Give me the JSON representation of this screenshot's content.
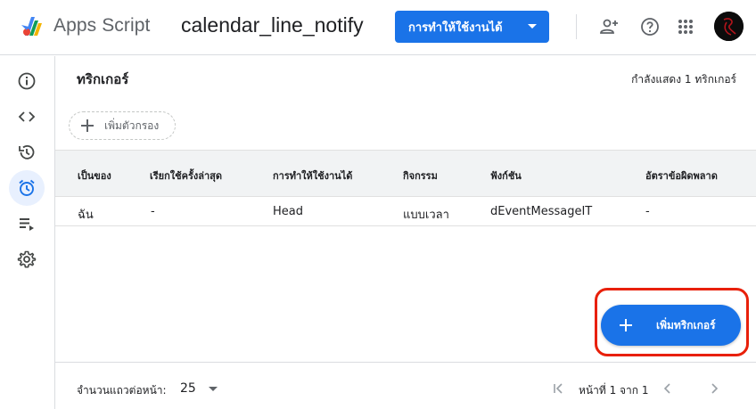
{
  "header": {
    "app_name": "Apps Script",
    "project_name": "calendar_line_notify",
    "deploy_label": "การทำให้ใช้งานได้",
    "icons": [
      "logo-icon",
      "share-person-icon",
      "help-icon",
      "apps-grid-icon",
      "avatar"
    ]
  },
  "sidebar": {
    "items": [
      {
        "name": "overview",
        "icon": "info-icon",
        "active": false
      },
      {
        "name": "editor",
        "icon": "code-icon",
        "active": false
      },
      {
        "name": "executions",
        "icon": "history-icon",
        "active": false
      },
      {
        "name": "triggers",
        "icon": "alarm-clock-icon",
        "active": true
      },
      {
        "name": "executions-list",
        "icon": "playlist-play-icon",
        "active": false
      },
      {
        "name": "settings",
        "icon": "gear-icon",
        "active": false
      }
    ]
  },
  "main": {
    "title": "ทริกเกอร์",
    "showing_count": "กำลังแสดง 1 ทริกเกอร์",
    "filter_label": "เพิ่มตัวกรอง",
    "table": {
      "columns": [
        "เป็นของ",
        "เรียกใช้ครั้งล่าสุด",
        "การทำให้ใช้งานได้",
        "กิจกรรม",
        "ฟังก์ชัน",
        "อัตราข้อผิดพลาด"
      ],
      "rows": [
        [
          "ฉัน",
          "-",
          "Head",
          "แบบเวลา",
          "dEventMessageIT",
          "-"
        ]
      ]
    },
    "add_trigger_label": "เพิ่มทริกเกอร์"
  },
  "footer": {
    "rows_per_page_label": "จำนวนแถวต่อหน้า:",
    "rows_per_page_value": "25",
    "page_info": "หน้าที่ 1 จาก 1"
  },
  "colors": {
    "accent": "#1a73e8",
    "active_nav_bg": "#e8f0fe",
    "highlight_border": "#e8200a",
    "header_bg": "#f1f3f4"
  }
}
